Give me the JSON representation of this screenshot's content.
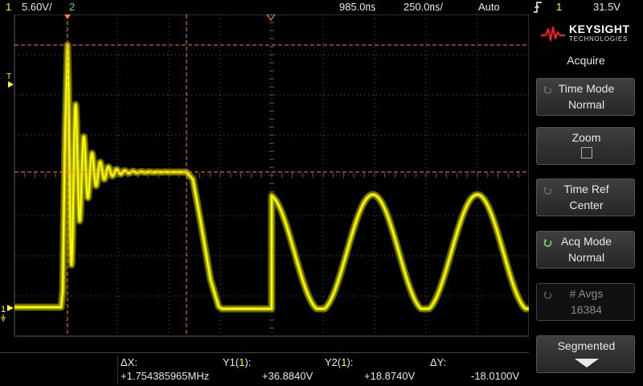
{
  "status_bar": {
    "ch1_number": "1",
    "ch1_scale": "5.60V/",
    "ch2_number": "2",
    "timebase_delay": "985.0㎱",
    "timebase_scale": "250.0㎱/",
    "trigger_mode": "Auto",
    "trigger_icon": "trigger-edge-icon",
    "trigger_channel": "1",
    "trigger_level": "31.5V"
  },
  "measurements": {
    "delta_x_label": "ΔX:",
    "delta_x_value": "+1.754385965MHz",
    "y1_label_pre": "Y1(",
    "y1_channel": "1",
    "y1_label_post": "):",
    "y1_value": "+36.8840V",
    "y2_label_pre": "Y2(",
    "y2_channel": "1",
    "y2_label_post": "):",
    "y2_value": "+18.8740V",
    "delta_y_label": "ΔY:",
    "delta_y_value": "-18.0100V"
  },
  "markers": {
    "trigger_marker": "T",
    "ground_marker": "1"
  },
  "panel": {
    "brand": "KEYSIGHT",
    "brand_sub": "TECHNOLOGIES",
    "menu_title": "Acquire",
    "softkeys": [
      {
        "line1": "Time Mode",
        "line2": "Normal",
        "knob": true
      },
      {
        "line1": "Zoom",
        "line2": "",
        "knob": false
      },
      {
        "line1": "Time Ref",
        "line2": "Center",
        "knob": true
      },
      {
        "line1": "Acq Mode",
        "line2": "Normal",
        "knob": true
      },
      {
        "line1": "# Avgs",
        "line2": "16384",
        "knob": true
      },
      {
        "line1": "Segmented",
        "line2": "",
        "knob": false
      }
    ]
  },
  "colors": {
    "channel1": "#ffff00",
    "channel2": "#6cd46c",
    "cursor": "#ff8040",
    "grid": "#5a5a5a",
    "panel_button": "#303030"
  }
}
